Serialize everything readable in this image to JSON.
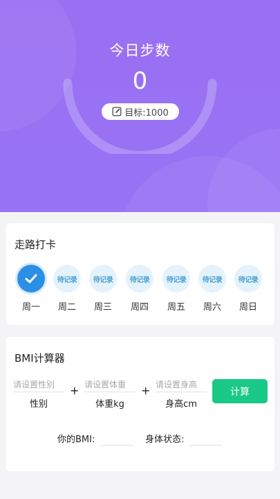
{
  "header": {
    "title": "今日步数",
    "steps": "0",
    "target_label": "目标:1000",
    "accent": "#9a6ff2"
  },
  "walk_card": {
    "title": "走路打卡",
    "days": [
      {
        "label": "周一",
        "status": "checked",
        "status_text": ""
      },
      {
        "label": "周二",
        "status": "pending",
        "status_text": "待记录"
      },
      {
        "label": "周三",
        "status": "pending",
        "status_text": "待记录"
      },
      {
        "label": "周四",
        "status": "pending",
        "status_text": "待记录"
      },
      {
        "label": "周五",
        "status": "pending",
        "status_text": "待记录"
      },
      {
        "label": "周六",
        "status": "pending",
        "status_text": "待记录"
      },
      {
        "label": "周日",
        "status": "pending",
        "status_text": "待记录"
      }
    ]
  },
  "bmi_card": {
    "title": "BMI计算器",
    "gender": {
      "placeholder": "请设置性别",
      "value": "",
      "label": "性别"
    },
    "weight": {
      "placeholder": "请设置体重",
      "value": "",
      "label": "体重kg"
    },
    "height": {
      "placeholder": "请设置身高",
      "value": "",
      "label": "身高cm"
    },
    "plus": "+",
    "calc_label": "计算",
    "calc_color": "#1bc986",
    "result_bmi_label": "你的BMI:",
    "result_bmi_value": "",
    "result_status_label": "身体状态:",
    "result_status_value": ""
  },
  "icons": {
    "check": "check-icon",
    "edit": "edit-icon"
  }
}
